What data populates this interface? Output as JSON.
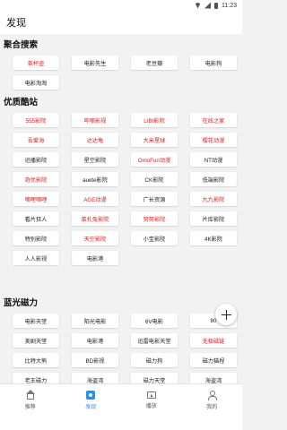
{
  "status_bar": {
    "time": "11:23"
  },
  "header": {
    "title": "发现"
  },
  "sections": [
    {
      "title": "聚合搜索",
      "items": [
        {
          "label": "茶杯壶",
          "red": true
        },
        {
          "label": "电影先生",
          "red": false
        },
        {
          "label": "老豆瓣",
          "red": false
        },
        {
          "label": "电影狗",
          "red": false
        },
        {
          "label": "电影淘淘",
          "red": false
        }
      ]
    },
    {
      "title": "优质酷站",
      "items": [
        {
          "label": "555影院",
          "red": true
        },
        {
          "label": "哔嘀影视",
          "red": true
        },
        {
          "label": "LIBI影院",
          "red": true
        },
        {
          "label": "在线之家",
          "red": true
        },
        {
          "label": "吾爱海",
          "red": true
        },
        {
          "label": "达达龟",
          "red": true
        },
        {
          "label": "大米星球",
          "red": true
        },
        {
          "label": "樱花动漫",
          "red": true
        },
        {
          "label": "迅播影院",
          "red": false
        },
        {
          "label": "星空影院",
          "red": false
        },
        {
          "label": "OmoFun动漫",
          "red": true
        },
        {
          "label": "NT动漫",
          "red": false
        },
        {
          "label": "奇优影院",
          "red": true
        },
        {
          "label": "auete影院",
          "red": false
        },
        {
          "label": "CK影院",
          "red": false
        },
        {
          "label": "低端影院",
          "red": false
        },
        {
          "label": "嘀哩嘀哩",
          "red": true
        },
        {
          "label": "AGE动漫",
          "red": true
        },
        {
          "label": "广长资源",
          "red": false
        },
        {
          "label": "九九影院",
          "red": true
        },
        {
          "label": "看片狂人",
          "red": false
        },
        {
          "label": "菜扎兔影院",
          "red": true
        },
        {
          "label": "努努影院",
          "red": true
        },
        {
          "label": "片库影院",
          "red": false
        },
        {
          "label": "特别影院",
          "red": false
        },
        {
          "label": "天空影院",
          "red": true
        },
        {
          "label": "小宝影院",
          "red": false
        },
        {
          "label": "4K影院",
          "red": false
        },
        {
          "label": "人人影视",
          "red": false
        },
        {
          "label": "电影港",
          "red": false
        }
      ]
    },
    {
      "title": "蓝光磁力",
      "items": [
        {
          "label": "电影天堂",
          "red": false
        },
        {
          "label": "阳光电影",
          "red": false
        },
        {
          "label": "6V电影",
          "red": false
        },
        {
          "label": "80",
          "red": false
        },
        {
          "label": "美剧天堂",
          "red": false
        },
        {
          "label": "电影港",
          "red": false
        },
        {
          "label": "迅雷电影天堂",
          "red": false
        },
        {
          "label": "无极磁链",
          "red": true
        },
        {
          "label": "比特大熊",
          "red": false
        },
        {
          "label": "BD影视",
          "red": false
        },
        {
          "label": "磁力狗",
          "red": false
        },
        {
          "label": "磁力猫捏",
          "red": false
        },
        {
          "label": "老王磁力",
          "red": false
        },
        {
          "label": "海盗湾",
          "red": false
        },
        {
          "label": "磁力天堂",
          "red": false
        },
        {
          "label": "海盗湾",
          "red": false
        }
      ]
    }
  ],
  "bottom_nav": [
    {
      "label": "推荐",
      "icon": "home-icon",
      "active": false
    },
    {
      "label": "发现",
      "icon": "discover-icon",
      "active": true
    },
    {
      "label": "播放",
      "icon": "play-icon",
      "active": false
    },
    {
      "label": "我的",
      "icon": "user-icon",
      "active": false
    }
  ],
  "colors": {
    "accent": "#2d8cf0",
    "red_text": "#d21f1f"
  }
}
